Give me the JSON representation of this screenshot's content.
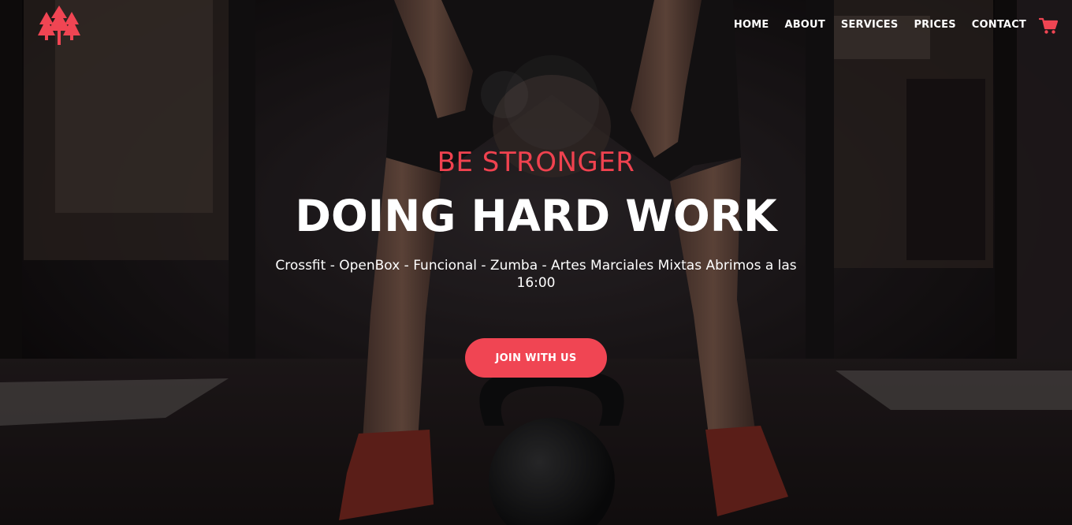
{
  "brand": {
    "logo_icon": "trees-logo-icon",
    "accent_color": "#f04553"
  },
  "nav": {
    "items": [
      {
        "label": "HOME"
      },
      {
        "label": "ABOUT"
      },
      {
        "label": "SERVICES"
      },
      {
        "label": "PRICES"
      },
      {
        "label": "CONTACT"
      }
    ],
    "cart_icon": "shopping-cart-icon"
  },
  "hero": {
    "tagline": "BE STRONGER",
    "headline": "DOING HARD WORK",
    "subtitle": "Crossfit - OpenBox - Funcional - Zumba - Artes Marciales Mixtas Abrimos a las 16:00",
    "cta_label": "JOIN WITH US"
  }
}
